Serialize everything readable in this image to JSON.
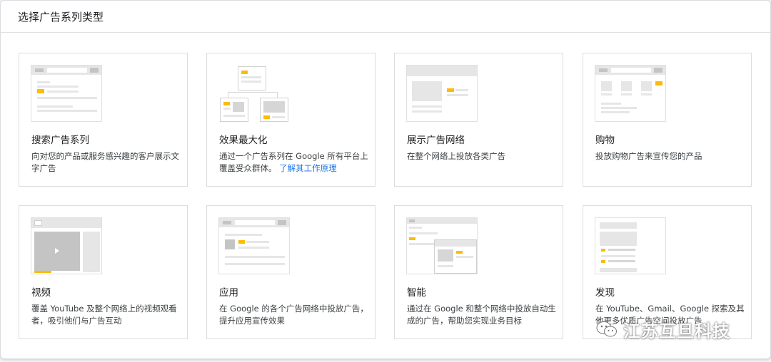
{
  "header": {
    "title": "选择广告系列类型"
  },
  "cards": [
    {
      "title": "搜索广告系列",
      "description": "向对您的产品或服务感兴趣的客户展示文字广告",
      "link": ""
    },
    {
      "title": "效果最大化",
      "description": "通过一个广告系列在 Google 所有平台上覆盖受众群体。 ",
      "link": "了解其工作原理"
    },
    {
      "title": "展示广告网络",
      "description": "在整个网络上投放各类广告",
      "link": ""
    },
    {
      "title": "购物",
      "description": "投放购物广告来宣传您的产品",
      "link": ""
    },
    {
      "title": "视频",
      "description": "覆盖 YouTube 及整个网络上的视频观看者，吸引他们与广告互动",
      "link": ""
    },
    {
      "title": "应用",
      "description": "在 Google 的各个广告网络中投放广告，提升应用宣传效果",
      "link": ""
    },
    {
      "title": "智能",
      "description": "通过在 Google 和整个网络中投放自动生成的广告，帮助您实现业务目标",
      "link": ""
    },
    {
      "title": "发现",
      "description": "在 YouTube、Gmail、Google 探索及其他更多优质广告空间投放广告",
      "link": ""
    }
  ],
  "watermark": {
    "text": "江苏互旦科技"
  },
  "colors": {
    "accent": "#fbbc04",
    "link": "#1a73e8"
  }
}
